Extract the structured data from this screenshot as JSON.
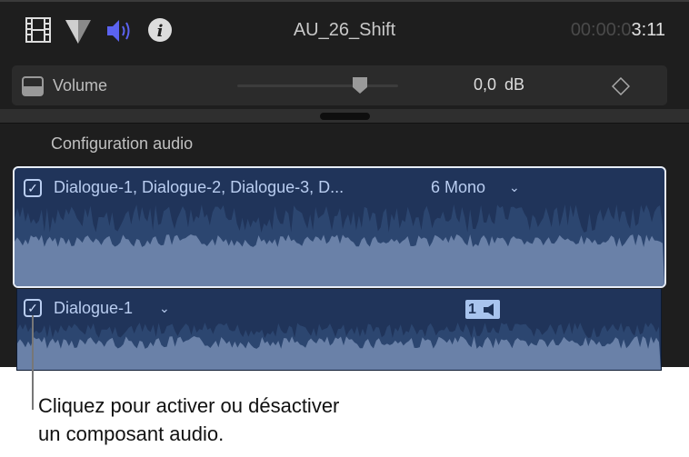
{
  "toolbar": {
    "title": "AU_26_Shift",
    "timecode_dim": "00:00:0",
    "timecode_bright": "3:11",
    "icons": [
      "film-icon",
      "color-icon",
      "audio-icon",
      "info-icon"
    ],
    "accent": "#5b63f0"
  },
  "volume": {
    "label": "Volume",
    "value": "0,0 dB",
    "level": 0.75
  },
  "section": {
    "title": "Configuration audio"
  },
  "clips": [
    {
      "label": "Dialogue-1, Dialogue-2, Dialogue-3, D...",
      "config": "6 Mono",
      "checked": true
    },
    {
      "label": "Dialogue-1",
      "channel_badge": "1",
      "checked": true
    }
  ],
  "callout": {
    "line1": "Cliquez pour activer ou désactiver",
    "line2": "un composant audio."
  }
}
